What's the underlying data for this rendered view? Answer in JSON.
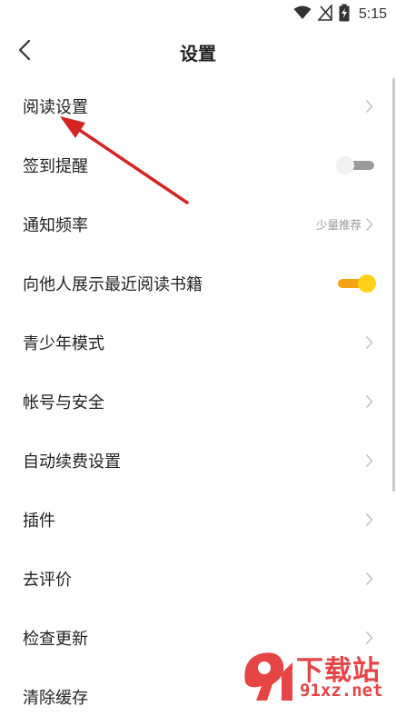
{
  "status_bar": {
    "time": "5:15",
    "icons": [
      "wifi-icon",
      "no-signal-icon",
      "battery-charging-icon"
    ]
  },
  "header": {
    "back_icon": "chevron-left-icon",
    "title": "设置"
  },
  "settings": {
    "items": [
      {
        "label": "阅读设置",
        "control": "chevron"
      },
      {
        "label": "签到提醒",
        "control": "toggle",
        "enabled": false
      },
      {
        "label": "通知频率",
        "control": "chevron",
        "value": "少量推荐"
      },
      {
        "label": "向他人展示最近阅读书籍",
        "control": "toggle",
        "enabled": true
      },
      {
        "label": "青少年模式",
        "control": "chevron"
      },
      {
        "label": "帐号与安全",
        "control": "chevron"
      },
      {
        "label": "自动续费设置",
        "control": "chevron"
      },
      {
        "label": "插件",
        "control": "chevron"
      },
      {
        "label": "去评价",
        "control": "chevron"
      },
      {
        "label": "检查更新",
        "control": "chevron"
      },
      {
        "label": "清除缓存",
        "control": "chevron"
      }
    ]
  },
  "colors": {
    "toggle_on_track": "#f5a214",
    "toggle_on_knob": "#ffd21a",
    "toggle_off_track": "#9b9b9b",
    "annotation_arrow": "#d42424",
    "watermark": "#e64545"
  },
  "watermark": {
    "main_text": "下载站",
    "sub_text": "91xz.net"
  }
}
